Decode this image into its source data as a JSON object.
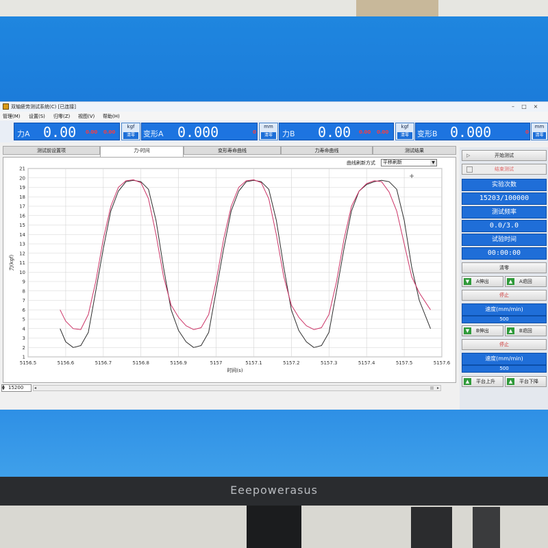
{
  "window": {
    "title": "双轴疲劳测试系统(C) [已连接]",
    "menu": [
      "管理(M)",
      "设置(S)",
      "归零(Z)",
      "视图(V)",
      "帮助(H)"
    ]
  },
  "readouts": {
    "force_a_label": "力A",
    "force_a_value": "0.00",
    "force_a_red1": "0.00",
    "force_a_red2": "0.00",
    "force_a_unit": "kgf",
    "force_a_clear": "清零",
    "deform_a_label": "变形A",
    "deform_a_value": "0.000",
    "deform_a_red": "0",
    "deform_a_unit": "mm",
    "deform_a_clear": "清零",
    "force_b_label": "力B",
    "force_b_value": "0.00",
    "force_b_red1": "0.00",
    "force_b_red2": "0.00",
    "force_b_unit": "kgf",
    "force_b_clear": "清零",
    "deform_b_label": "变形B",
    "deform_b_value": "0.000",
    "deform_b_red": "0",
    "deform_b_unit": "mm",
    "deform_b_clear": "清零"
  },
  "tabs": [
    "测试前设置项",
    "力-时间",
    "变形寿命曲线",
    "力寿命曲线",
    "测试结果"
  ],
  "refresh": {
    "label": "曲线刷新方式",
    "value": "平移刷新"
  },
  "scroll": {
    "spin_value": "15200"
  },
  "right_panel": {
    "start_button": "开始测试",
    "end_button": "结束测试",
    "count_label": "实验次数",
    "count_value": "15203/100000",
    "freq_label": "测试频率",
    "freq_value": "0.0/3.0",
    "time_label": "试验时间",
    "time_value": "00:00:00",
    "zero_button": "清零",
    "a_extend": "A伸出",
    "a_retract": "A退回",
    "stop_a": "停止",
    "speed_label_a": "速度(mm/min)",
    "speed_value_a": "500",
    "b_extend": "B伸出",
    "b_retract": "B退回",
    "stop_b": "停止",
    "speed_label_b": "速度(mm/min)",
    "speed_value_b": "500",
    "platform_up": "平台上升",
    "platform_down": "平台下降"
  },
  "monitor": {
    "brand": "Eeepowerasus"
  },
  "chart_data": {
    "type": "line",
    "xlabel": "时间(s)",
    "ylabel": "力(kgf)",
    "xlim": [
      5156.5,
      5157.6
    ],
    "ylim": [
      1,
      21
    ],
    "x_ticks": [
      "5156.5",
      "5156.6",
      "5156.7",
      "5156.8",
      "5156.9",
      "5157",
      "5157.1",
      "5157.2",
      "5157.3",
      "5157.4",
      "5157.5",
      "5157.6"
    ],
    "y_ticks": [
      "1",
      "2",
      "3",
      "4",
      "5",
      "6",
      "7",
      "8",
      "9",
      "10",
      "11",
      "12",
      "13",
      "14",
      "15",
      "16",
      "17",
      "18",
      "19",
      "20",
      "21"
    ],
    "grid": true,
    "series": [
      {
        "color": "#2b2b2b",
        "points": [
          [
            5156.585,
            4.0
          ],
          [
            5156.6,
            2.6
          ],
          [
            5156.62,
            2.0
          ],
          [
            5156.64,
            2.2
          ],
          [
            5156.66,
            3.6
          ],
          [
            5156.68,
            8.0
          ],
          [
            5156.7,
            12.5
          ],
          [
            5156.72,
            16.5
          ],
          [
            5156.74,
            18.6
          ],
          [
            5156.76,
            19.6
          ],
          [
            5156.78,
            19.75
          ],
          [
            5156.8,
            19.6
          ],
          [
            5156.82,
            18.8
          ],
          [
            5156.84,
            15.5
          ],
          [
            5156.86,
            10.5
          ],
          [
            5156.88,
            6.0
          ],
          [
            5156.9,
            3.8
          ],
          [
            5156.92,
            2.6
          ],
          [
            5156.94,
            2.0
          ],
          [
            5156.96,
            2.2
          ],
          [
            5156.98,
            3.6
          ],
          [
            5157.0,
            8.0
          ],
          [
            5157.02,
            12.5
          ],
          [
            5157.04,
            16.5
          ],
          [
            5157.06,
            18.6
          ],
          [
            5157.08,
            19.6
          ],
          [
            5157.1,
            19.75
          ],
          [
            5157.12,
            19.6
          ],
          [
            5157.14,
            18.8
          ],
          [
            5157.16,
            15.5
          ],
          [
            5157.18,
            10.5
          ],
          [
            5157.2,
            6.0
          ],
          [
            5157.22,
            3.8
          ],
          [
            5157.24,
            2.6
          ],
          [
            5157.26,
            2.0
          ],
          [
            5157.28,
            2.2
          ],
          [
            5157.3,
            3.6
          ],
          [
            5157.32,
            8.0
          ],
          [
            5157.34,
            12.5
          ],
          [
            5157.36,
            16.5
          ],
          [
            5157.38,
            18.6
          ],
          [
            5157.4,
            19.3
          ],
          [
            5157.42,
            19.6
          ],
          [
            5157.44,
            19.75
          ],
          [
            5157.46,
            19.6
          ],
          [
            5157.48,
            18.8
          ],
          [
            5157.5,
            15.5
          ],
          [
            5157.52,
            10.5
          ],
          [
            5157.54,
            7.0
          ],
          [
            5157.57,
            4.0
          ]
        ]
      },
      {
        "color": "#cc3366",
        "points": [
          [
            5156.585,
            6.0
          ],
          [
            5156.6,
            4.8
          ],
          [
            5156.62,
            4.0
          ],
          [
            5156.64,
            3.9
          ],
          [
            5156.66,
            5.5
          ],
          [
            5156.68,
            9.0
          ],
          [
            5156.7,
            13.5
          ],
          [
            5156.72,
            17.0
          ],
          [
            5156.74,
            19.0
          ],
          [
            5156.76,
            19.7
          ],
          [
            5156.78,
            19.8
          ],
          [
            5156.8,
            19.5
          ],
          [
            5156.82,
            17.8
          ],
          [
            5156.84,
            14.0
          ],
          [
            5156.86,
            9.5
          ],
          [
            5156.88,
            6.5
          ],
          [
            5156.9,
            5.2
          ],
          [
            5156.92,
            4.3
          ],
          [
            5156.94,
            3.9
          ],
          [
            5156.96,
            4.1
          ],
          [
            5156.98,
            5.5
          ],
          [
            5157.0,
            9.0
          ],
          [
            5157.02,
            13.5
          ],
          [
            5157.04,
            17.0
          ],
          [
            5157.06,
            19.0
          ],
          [
            5157.08,
            19.7
          ],
          [
            5157.1,
            19.8
          ],
          [
            5157.12,
            19.5
          ],
          [
            5157.14,
            17.8
          ],
          [
            5157.16,
            14.0
          ],
          [
            5157.18,
            9.5
          ],
          [
            5157.2,
            6.5
          ],
          [
            5157.22,
            5.2
          ],
          [
            5157.24,
            4.3
          ],
          [
            5157.26,
            3.9
          ],
          [
            5157.28,
            4.1
          ],
          [
            5157.3,
            5.5
          ],
          [
            5157.32,
            9.0
          ],
          [
            5157.34,
            13.5
          ],
          [
            5157.36,
            17.0
          ],
          [
            5157.38,
            18.6
          ],
          [
            5157.4,
            19.4
          ],
          [
            5157.42,
            19.7
          ],
          [
            5157.44,
            19.6
          ],
          [
            5157.46,
            18.5
          ],
          [
            5157.48,
            16.5
          ],
          [
            5157.5,
            13.0
          ],
          [
            5157.52,
            9.5
          ],
          [
            5157.54,
            7.8
          ],
          [
            5157.57,
            6.0
          ]
        ]
      }
    ]
  }
}
